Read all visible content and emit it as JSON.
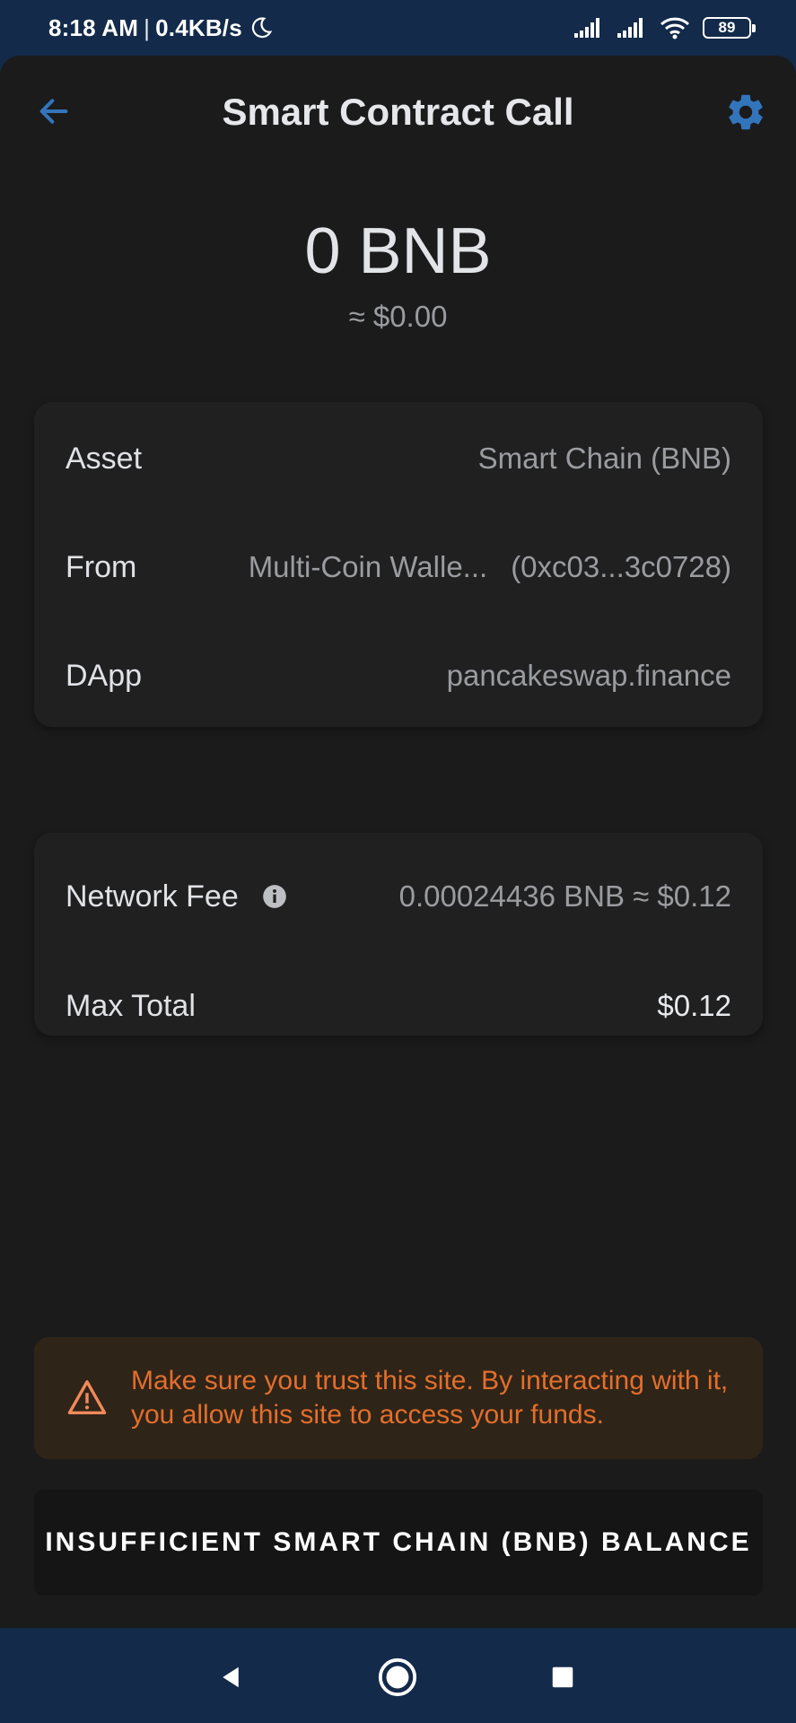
{
  "status_bar": {
    "time": "8:18 AM",
    "separator": "|",
    "speed": "0.4KB/s",
    "battery": "89"
  },
  "header": {
    "title": "Smart Contract Call",
    "back_icon": "arrow-left-icon",
    "settings_icon": "gear-icon",
    "accent_color": "#3375bb"
  },
  "amount": {
    "crypto": "0 BNB",
    "fiat": "≈ $0.00"
  },
  "details": [
    {
      "label": "Asset",
      "value": "Smart Chain (BNB)"
    },
    {
      "label": "From",
      "wallet": "Multi-Coin Walle...",
      "address": "(0xc03...3c0728)"
    },
    {
      "label": "DApp",
      "value": "pancakeswap.finance"
    }
  ],
  "fees": {
    "network_fee_label": "Network Fee",
    "network_fee_value": "0.00024436 BNB ≈ $0.12",
    "max_total_label": "Max Total",
    "max_total_value": "$0.12"
  },
  "warning": {
    "text": "Make sure you trust this site. By interacting with it, you allow this site to access your funds.",
    "color": "#e36f2c"
  },
  "action": {
    "label": "INSUFFICIENT SMART CHAIN (BNB) BALANCE"
  },
  "nav": {
    "back_icon": "triangle-back-icon",
    "home_icon": "circle-home-icon",
    "recents_icon": "square-recents-icon"
  }
}
